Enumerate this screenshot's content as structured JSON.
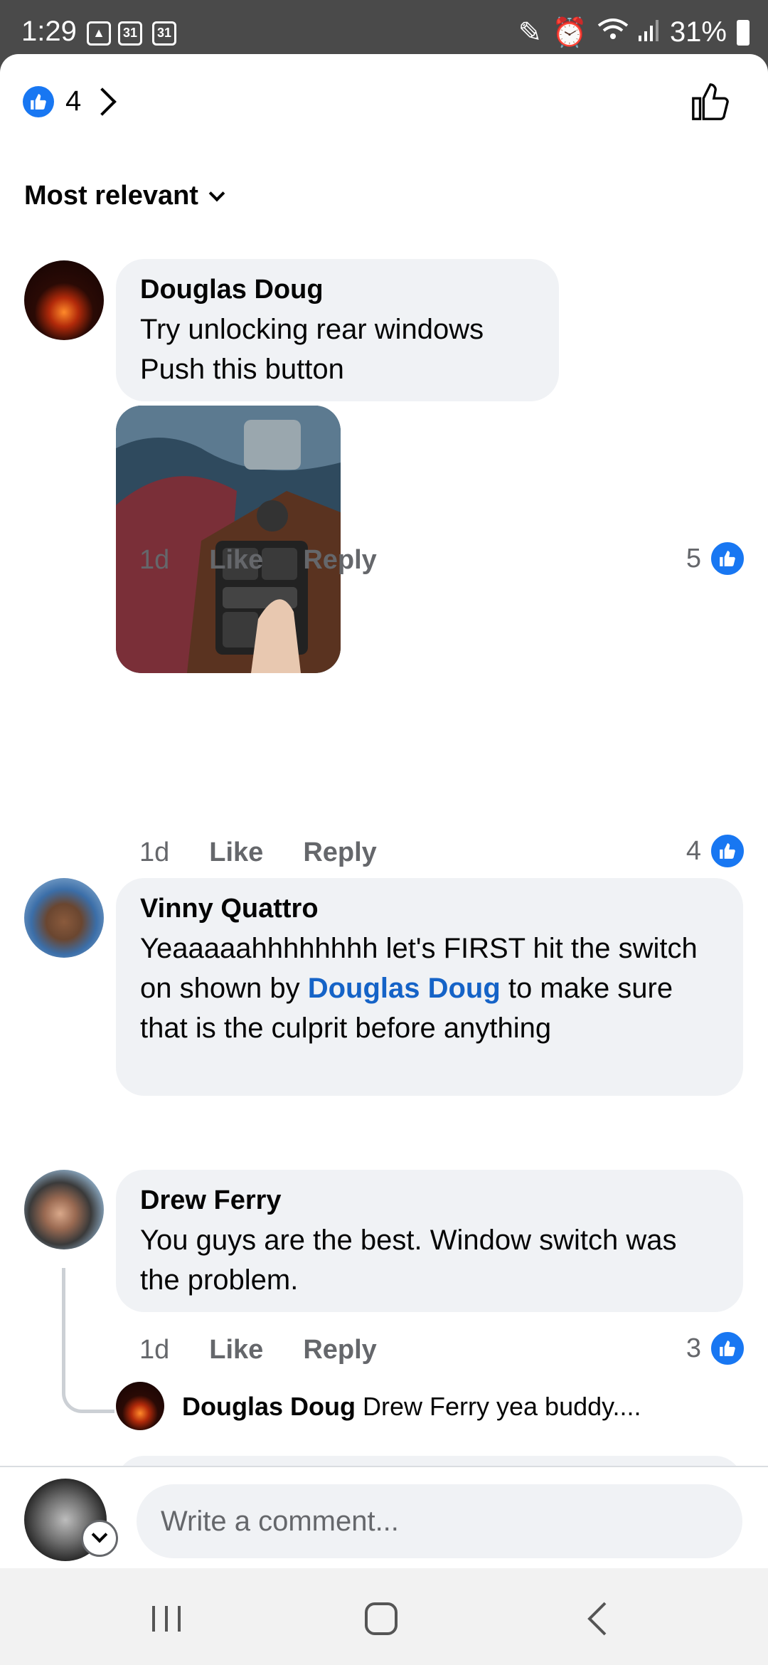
{
  "status_bar": {
    "time": "1:29",
    "calendar_1": "31",
    "calendar_2": "31",
    "battery": "31%"
  },
  "header": {
    "reaction_count": "4",
    "sort_label": "Most relevant"
  },
  "comments": [
    {
      "author": "Douglas Doug",
      "text_line1": "Try unlocking  rear windows",
      "text_line2": "Push this button",
      "time": "1d",
      "like": "Like",
      "reply": "Reply",
      "likes": "5"
    },
    {
      "author": "Vinny Quattro",
      "text_before": "Yeaaaaahhhhhhhh let's FIRST hit the switch on shown by ",
      "mention": "Douglas Doug",
      "text_after": " to make sure that is the culprit before anything",
      "time": "1d",
      "like": "Like",
      "reply": "Reply",
      "likes": "4"
    },
    {
      "author": "Drew Ferry",
      "text": "You guys are the best. Window switch was the problem.",
      "time": "1d",
      "like": "Like",
      "reply": "Reply",
      "likes": "3",
      "reply_preview": {
        "author": "Douglas Doug",
        "text": "Drew Ferry yea buddy...."
      }
    }
  ],
  "composer": {
    "placeholder": "Write a comment..."
  },
  "colors": {
    "accent": "#1877f2",
    "mention": "#1563c7",
    "bubble": "#f0f2f5",
    "muted_text": "#65676b"
  },
  "icons": [
    "like-thumb-icon",
    "chevron-right-icon",
    "chevron-down-icon",
    "recents-icon",
    "home-icon",
    "back-icon",
    "image-icon",
    "calendar-icon",
    "pen-icon",
    "alarm-icon",
    "wifi-icon",
    "signal-icon",
    "battery-icon"
  ]
}
